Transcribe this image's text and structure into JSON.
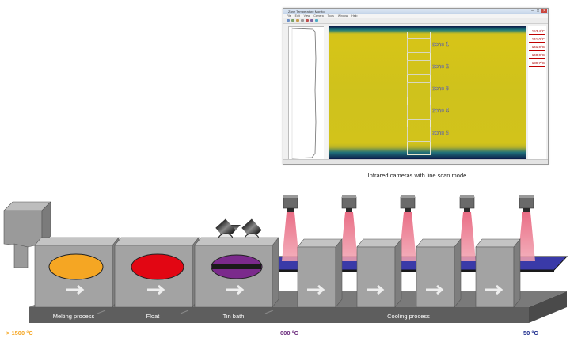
{
  "software": {
    "window_title": "Zone Temperature Monitor",
    "menu": [
      "File",
      "Edit",
      "View",
      "Camera",
      "Tools",
      "Window",
      "Help"
    ],
    "zones": [
      "zone 1",
      "zone 2",
      "zone 3",
      "zone 4",
      "zone 5"
    ],
    "readings": [
      "153,4°C",
      "141,0°C",
      "141,0°C",
      "140,0°C",
      "139,7°C"
    ]
  },
  "caption": "Infrared cameras  with line scan mode",
  "stages": [
    "Melting process",
    "Float",
    "Tin bath",
    "Cooling  process"
  ],
  "temperatures": {
    "start": "> 1500 °C",
    "middle": "600 °C",
    "end": "50 °C"
  },
  "colors": {
    "melt": "#f5a623",
    "float": "#e20613",
    "tin_bath_glass": "#7b2a8c",
    "glass_ribbon": "#3a3aa8",
    "laser_beam": "#e8667f",
    "temp_hot": "#f5a623",
    "temp_mid": "#6a2a7c",
    "temp_cold": "#1a2a8c"
  }
}
